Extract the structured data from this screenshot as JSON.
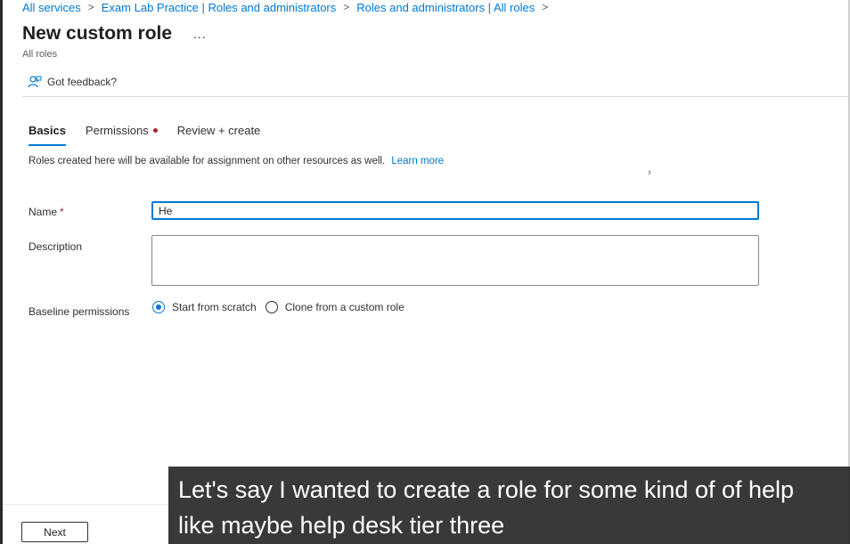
{
  "breadcrumb": [
    {
      "label": "All services"
    },
    {
      "label": "Exam Lab Practice | Roles and administrators"
    },
    {
      "label": "Roles and administrators | All roles"
    }
  ],
  "page": {
    "title": "New custom role",
    "more": "...",
    "subtitle": "All roles"
  },
  "toolbar": {
    "feedback_label": "Got feedback?"
  },
  "tabs": [
    {
      "label": "Basics",
      "active": true
    },
    {
      "label": "Permissions",
      "has_error": true
    },
    {
      "label": "Review + create"
    }
  ],
  "info": {
    "text": "Roles created here will be available for assignment on other resources as well.",
    "link": "Learn more"
  },
  "form": {
    "name_label": "Name",
    "required_mark": "*",
    "name_value": "He",
    "description_label": "Description",
    "description_value": "",
    "baseline_label": "Baseline permissions",
    "baseline_options": [
      {
        "label": "Start from scratch",
        "selected": true
      },
      {
        "label": "Clone from a custom role",
        "selected": false
      }
    ]
  },
  "footer": {
    "next_label": "Next"
  },
  "caption": {
    "line1": "Let's say I wanted to create a role for some kind of of help",
    "line2": "like maybe help desk tier three"
  },
  "colors": {
    "accent": "#0078d4",
    "error": "#a4262c"
  }
}
